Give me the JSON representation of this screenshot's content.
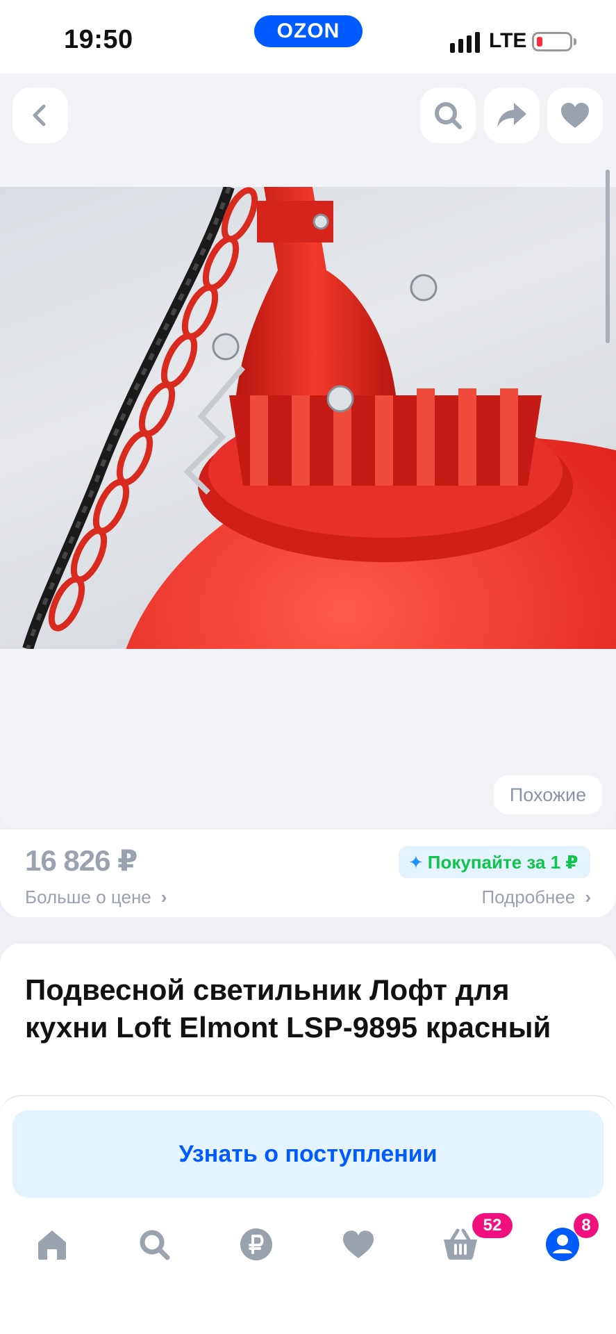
{
  "status_bar": {
    "time": "19:50",
    "brand": "OZON",
    "network": "LTE"
  },
  "gallery": {
    "image_alt": "Подвесной светильник красный",
    "similar_label": "Похожие"
  },
  "price_card": {
    "price": "16 826 ₽",
    "price_more": "Больше о цене",
    "promo": "Покупайте за 1 ₽",
    "details": "Подробнее"
  },
  "product": {
    "title": "Подвесной светильник Лофт для кухни Loft Elmont LSP-9895 красный"
  },
  "action": {
    "notify_label": "Узнать о поступлении"
  },
  "tabs": [
    {
      "name": "home",
      "icon": "home-icon"
    },
    {
      "name": "search",
      "icon": "search-icon"
    },
    {
      "name": "finance",
      "icon": "ruble-icon"
    },
    {
      "name": "favorites",
      "icon": "heart-icon"
    },
    {
      "name": "cart",
      "icon": "basket-icon",
      "badge": "52"
    },
    {
      "name": "profile",
      "icon": "profile-icon",
      "badge": "8"
    }
  ],
  "colors": {
    "brand_blue": "#005bff",
    "badge_pink": "#f1117e",
    "promo_green": "#10c44c",
    "icon_gray": "#9aa2ae"
  }
}
